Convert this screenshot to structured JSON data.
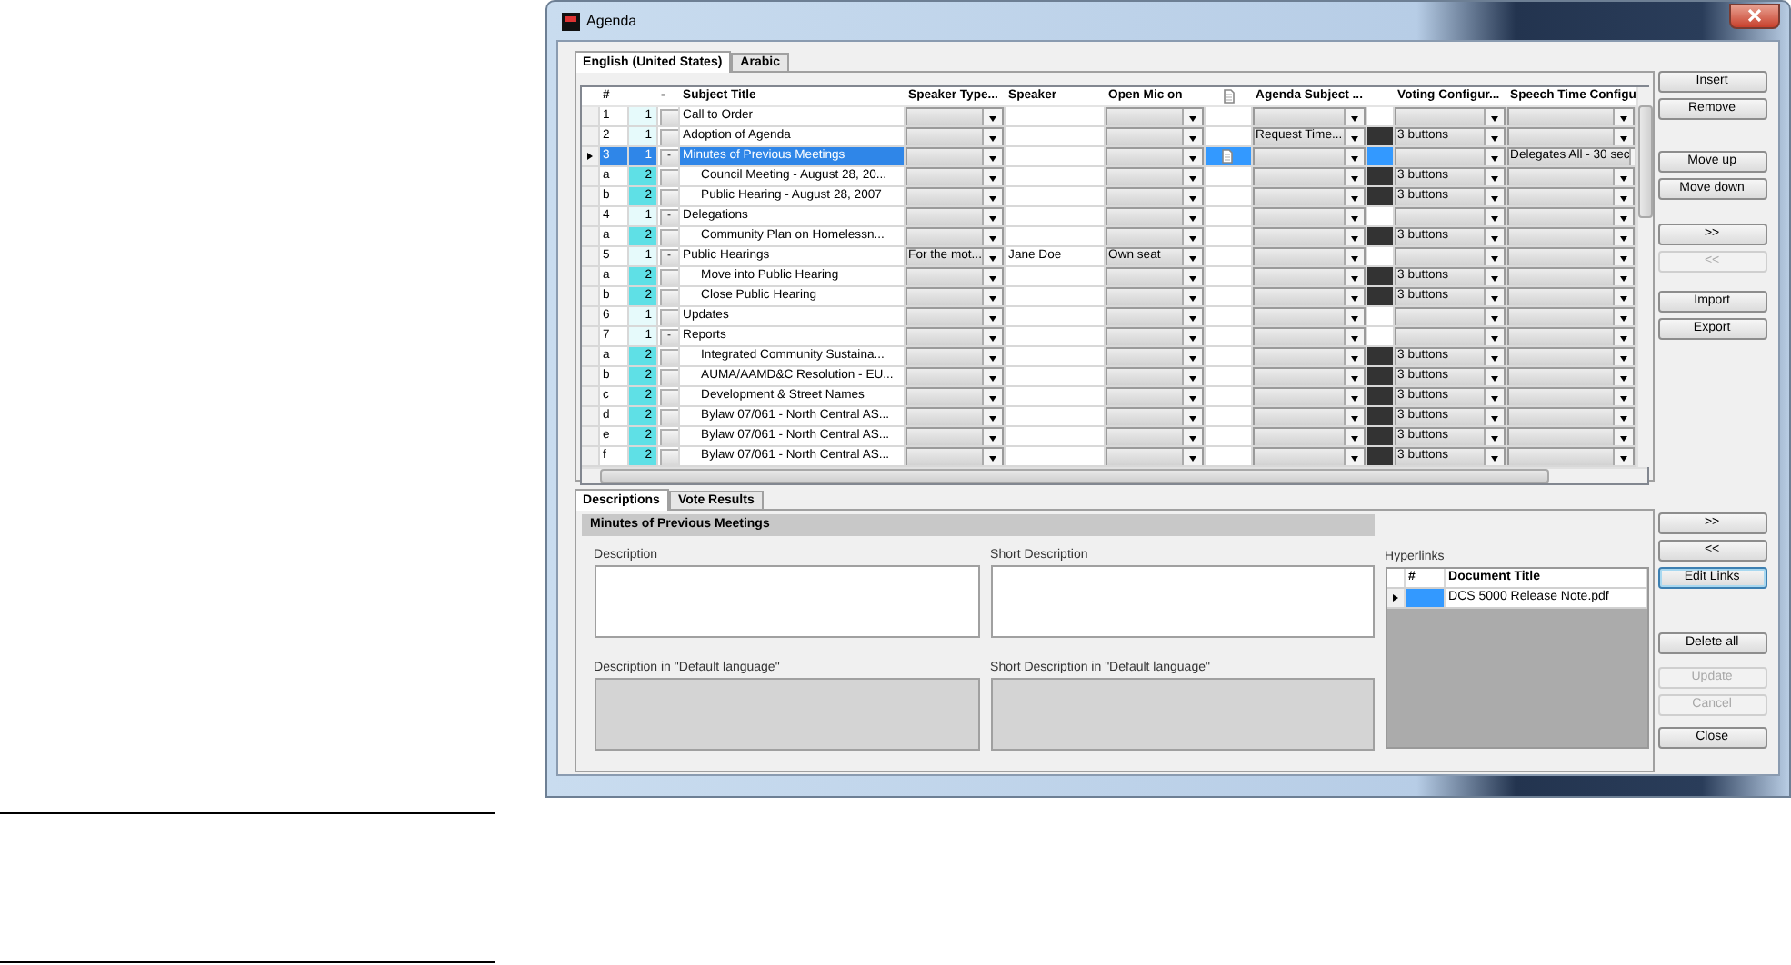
{
  "window": {
    "title": "Agenda"
  },
  "language_tabs": [
    {
      "label": "English (United States)",
      "selected": true
    },
    {
      "label": "Arabic",
      "selected": false
    }
  ],
  "grid": {
    "columns": [
      "#",
      "-",
      "Subject Title",
      "Speaker Type...",
      "Speaker",
      "Open Mic on",
      "Agenda Subject ...",
      "Voting Configur...",
      "Speech Time Configu"
    ],
    "rows": [
      {
        "number": "1",
        "level": "1",
        "subject": "Call to Order",
        "color": "#ffffff",
        "attachment": false,
        "selected": false
      },
      {
        "number": "2",
        "level": "1",
        "subject": "Adoption of Agenda",
        "agenda_subject": "Request Time...",
        "color": "#333333",
        "voting": "3 buttons",
        "attachment": false,
        "selected": false
      },
      {
        "number": "3",
        "level": "1",
        "expander": "-",
        "subject": "Minutes of Previous Meetings",
        "color": "#3399ff",
        "speech_time": "Delegates All - 30 sec",
        "attachment": true,
        "selected": true
      },
      {
        "number": "a",
        "level": "2",
        "subject": "Council Meeting - August 28, 20...",
        "color": "#333333",
        "voting": "3 buttons",
        "attachment": false,
        "selected": false
      },
      {
        "number": "b",
        "level": "2",
        "subject": "Public Hearing - August 28, 2007",
        "color": "#333333",
        "voting": "3 buttons",
        "attachment": false,
        "selected": false
      },
      {
        "number": "4",
        "level": "1",
        "expander": "-",
        "subject": "Delegations",
        "color": "#ffffff",
        "attachment": false,
        "selected": false
      },
      {
        "number": "a",
        "level": "2",
        "subject": "Community Plan on Homelessn...",
        "color": "#333333",
        "voting": "3 buttons",
        "attachment": false,
        "selected": false
      },
      {
        "number": "5",
        "level": "1",
        "expander": "-",
        "subject": "Public Hearings",
        "speaker_type": "For the mot...",
        "speaker": "Jane Doe",
        "open_mic": "Own seat",
        "color": "#ffffff",
        "attachment": false,
        "selected": false
      },
      {
        "number": "a",
        "level": "2",
        "subject": "Move into Public Hearing",
        "color": "#333333",
        "voting": "3 buttons",
        "attachment": false,
        "selected": false
      },
      {
        "number": "b",
        "level": "2",
        "subject": "Close Public Hearing",
        "color": "#333333",
        "voting": "3 buttons",
        "attachment": false,
        "selected": false
      },
      {
        "number": "6",
        "level": "1",
        "subject": "Updates",
        "color": "#ffffff",
        "attachment": false,
        "selected": false
      },
      {
        "number": "7",
        "level": "1",
        "expander": "-",
        "subject": "Reports",
        "color": "#ffffff",
        "attachment": false,
        "selected": false
      },
      {
        "number": "a",
        "level": "2",
        "subject": "Integrated Community Sustaina...",
        "color": "#333333",
        "voting": "3 buttons",
        "attachment": false,
        "selected": false
      },
      {
        "number": "b",
        "level": "2",
        "subject": "AUMA/AAMD&C Resolution - EU...",
        "color": "#333333",
        "voting": "3 buttons",
        "attachment": false,
        "selected": false
      },
      {
        "number": "c",
        "level": "2",
        "subject": "Development & Street Names",
        "color": "#333333",
        "voting": "3 buttons",
        "attachment": false,
        "selected": false
      },
      {
        "number": "d",
        "level": "2",
        "subject": "Bylaw 07/061 - North Central AS...",
        "color": "#333333",
        "voting": "3 buttons",
        "attachment": false,
        "selected": false
      },
      {
        "number": "e",
        "level": "2",
        "subject": "Bylaw 07/061 - North Central AS...",
        "color": "#333333",
        "voting": "3 buttons",
        "attachment": false,
        "selected": false
      },
      {
        "number": "f",
        "level": "2",
        "subject": "Bylaw 07/061 - North Central AS...",
        "color": "#333333",
        "voting": "3 buttons",
        "attachment": false,
        "selected": false
      }
    ]
  },
  "side_buttons": [
    [
      {
        "label": "Insert",
        "disabled": false
      },
      {
        "label": "Remove",
        "disabled": false
      }
    ],
    [
      {
        "label": "Move up",
        "disabled": false
      },
      {
        "label": "Move down",
        "disabled": false
      }
    ],
    [
      {
        "label": ">>",
        "disabled": false
      },
      {
        "label": "<<",
        "disabled": true
      }
    ],
    [
      {
        "label": "Import",
        "disabled": false
      },
      {
        "label": "Export",
        "disabled": false
      }
    ]
  ],
  "detail_tabs": [
    {
      "label": "Descriptions",
      "selected": true
    },
    {
      "label": "Vote Results",
      "selected": false
    }
  ],
  "detail": {
    "heading": "Minutes of Previous Meetings",
    "fields": [
      {
        "label": "Description",
        "disabled": false
      },
      {
        "label": "Short Description",
        "disabled": false
      },
      {
        "label": "Description in \"Default language\"",
        "disabled": true
      },
      {
        "label": "Short Description in \"Default language\"",
        "disabled": true
      }
    ],
    "hyperlinks": {
      "label": "Hyperlinks",
      "columns": [
        "#",
        "Document Title"
      ],
      "rows": [
        {
          "title": "DCS 5000 Release Note.pdf",
          "selected": true
        }
      ]
    }
  },
  "detail_buttons": [
    [
      {
        "label": ">>",
        "disabled": false,
        "focused": false
      },
      {
        "label": "<<",
        "disabled": false,
        "focused": false
      },
      {
        "label": "Edit Links",
        "disabled": false,
        "focused": true
      }
    ],
    [
      {
        "label": "Delete all",
        "disabled": false,
        "focused": false
      }
    ],
    [
      {
        "label": "Update",
        "disabled": true,
        "focused": false
      },
      {
        "label": "Cancel",
        "disabled": true,
        "focused": false
      }
    ],
    [
      {
        "label": "Close",
        "disabled": false,
        "focused": false
      }
    ]
  ]
}
